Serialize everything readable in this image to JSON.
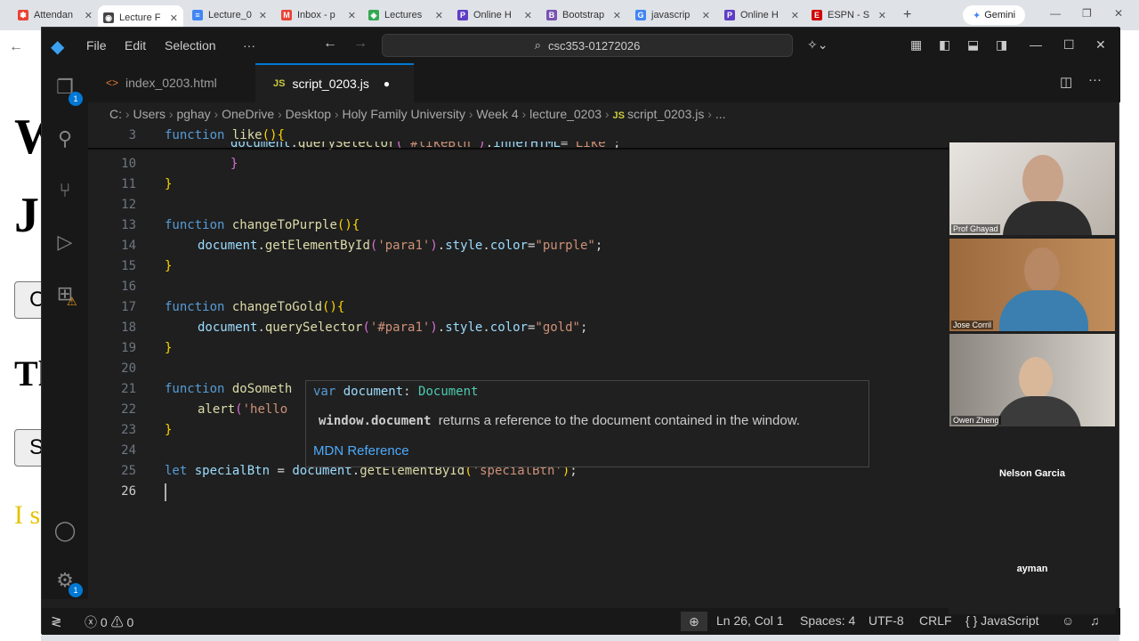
{
  "browser": {
    "tabs": [
      {
        "label": "Attendan",
        "color": "#e94235",
        "glyph": "✽"
      },
      {
        "label": "Lecture F",
        "color": "#444444",
        "glyph": "◉",
        "active": true
      },
      {
        "label": "Lecture_0",
        "color": "#4285f4",
        "glyph": "≡"
      },
      {
        "label": "Inbox - p",
        "color": "#ea4335",
        "glyph": "M"
      },
      {
        "label": "Lectures",
        "color": "#34a853",
        "glyph": "◈"
      },
      {
        "label": "Online H",
        "color": "#5f3dc4",
        "glyph": "P"
      },
      {
        "label": "Bootstrap",
        "color": "#7952b3",
        "glyph": "B"
      },
      {
        "label": "javascrip",
        "color": "#4285f4",
        "glyph": "G"
      },
      {
        "label": "Online H",
        "color": "#5f3dc4",
        "glyph": "P"
      },
      {
        "label": "ESPN - S",
        "color": "#d00000",
        "glyph": "E"
      }
    ],
    "new_tab": "+",
    "gemini_label": "Gemini"
  },
  "bgpage": {
    "glyphs": [
      "W",
      "J",
      "C",
      "Th",
      "S",
      "I s"
    ]
  },
  "vscode": {
    "menu": [
      "File",
      "Edit",
      "Selection",
      "···"
    ],
    "search_text": "csc353-01272026",
    "editor_tabs": [
      {
        "icon": "<>",
        "label": "index_0203.html",
        "active": false
      },
      {
        "icon": "JS",
        "label": "script_0203.js",
        "active": true,
        "modified": true
      }
    ],
    "breadcrumb": [
      "C:",
      "Users",
      "pghay",
      "OneDrive",
      "Desktop",
      "Holy Family University",
      "Week 4",
      "lecture_0203",
      "script_0203.js",
      "..."
    ],
    "activity_badges": {
      "explorer": "1",
      "settings": "1"
    },
    "hover": {
      "sig_kw": "var",
      "sig_name": "document",
      "sig_type": "Document",
      "desc_code": "window.document",
      "desc_text": "returns a reference to the document contained in the window.",
      "mdn": "MDN Reference"
    },
    "status": {
      "errors": "0",
      "warnings": "0",
      "position": "Ln 26, Col 1",
      "spaces": "Spaces: 4",
      "encoding": "UTF-8",
      "eol": "CRLF",
      "language": "JavaScript",
      "braces": "{ }"
    }
  },
  "video": {
    "participants": [
      {
        "name": "Prof Ghayad"
      },
      {
        "name": "Jose Corril"
      },
      {
        "name": "Owen Zheng"
      },
      {
        "name": "Nelson Garcia"
      },
      {
        "name": "ayman"
      }
    ]
  }
}
